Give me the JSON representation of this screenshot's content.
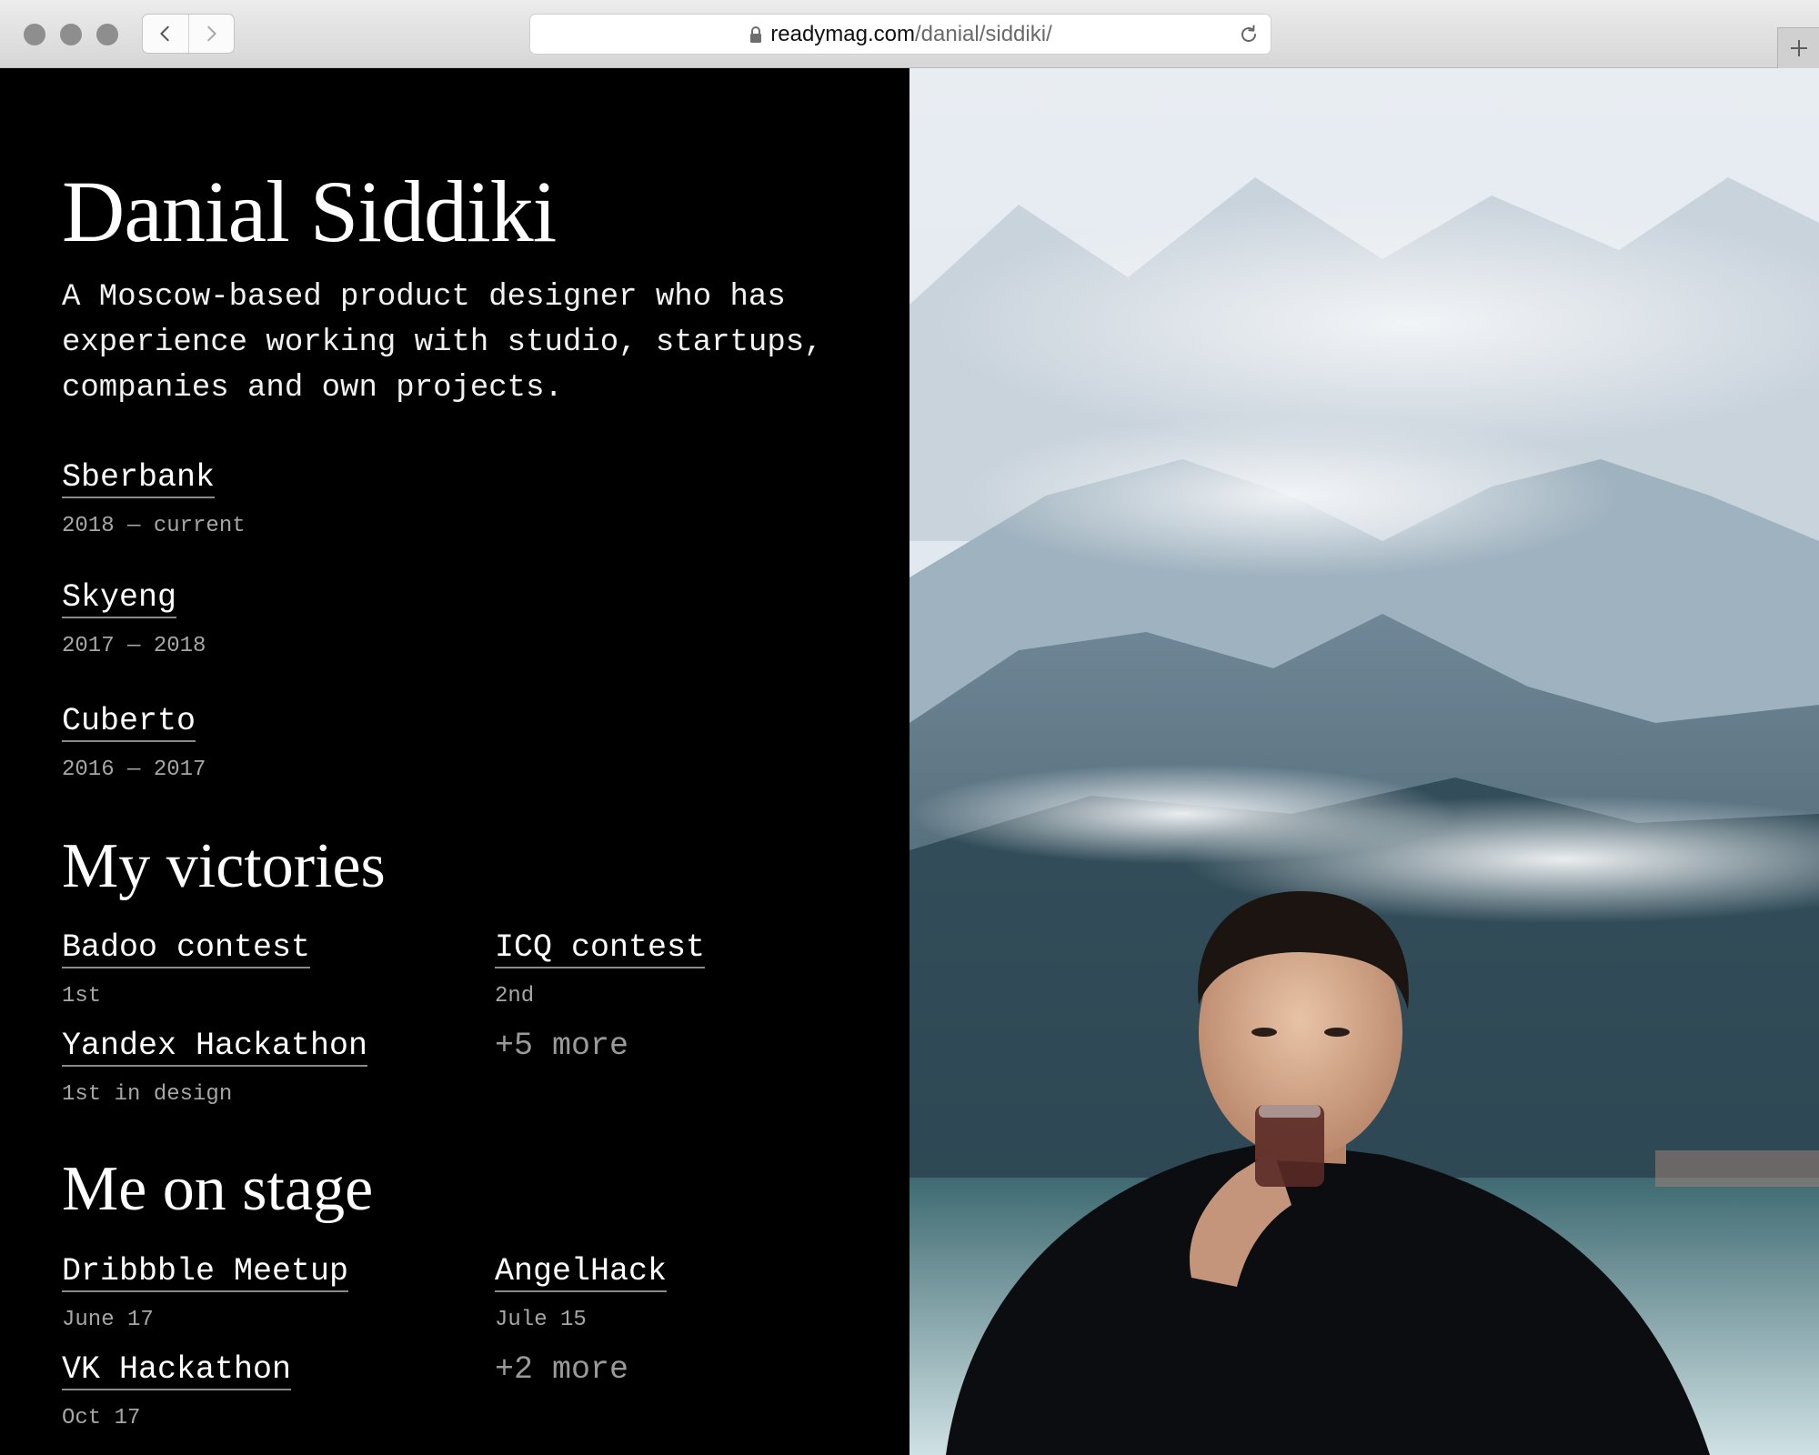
{
  "browser": {
    "url_host": "readymag.com",
    "url_path": "/danial/siddiki/",
    "icons": [
      "back-icon",
      "forward-icon",
      "lock-icon",
      "reload-icon",
      "plus-icon"
    ]
  },
  "profile": {
    "name": "Danial Siddiki",
    "bio": "A Moscow-based product designer who has experience working with studio, startups, companies and own projects."
  },
  "experience": [
    {
      "company": "Sberbank",
      "period": "2018 — current"
    },
    {
      "company": "Skyeng",
      "period": "2017 — 2018"
    },
    {
      "company": "Cuberto",
      "period": "2016 — 2017"
    }
  ],
  "victories": {
    "title": "My victories",
    "items": [
      {
        "name": "Badoo contest",
        "place": "1st"
      },
      {
        "name": "ICQ contest",
        "place": "2nd"
      },
      {
        "name": "Yandex Hackathon",
        "place": "1st in design"
      }
    ],
    "more": "+5 more"
  },
  "stage": {
    "title": "Me on stage",
    "items": [
      {
        "name": "Dribbble Meetup",
        "date": "June 17"
      },
      {
        "name": "AngelHack",
        "date": "Jule 15"
      },
      {
        "name": "VK Hackathon",
        "date": "Oct 17"
      }
    ],
    "more": "+2 more"
  },
  "colors": {
    "left_background": "#000000",
    "text": "#ffffff",
    "muted_text": "#a6a6a6"
  }
}
